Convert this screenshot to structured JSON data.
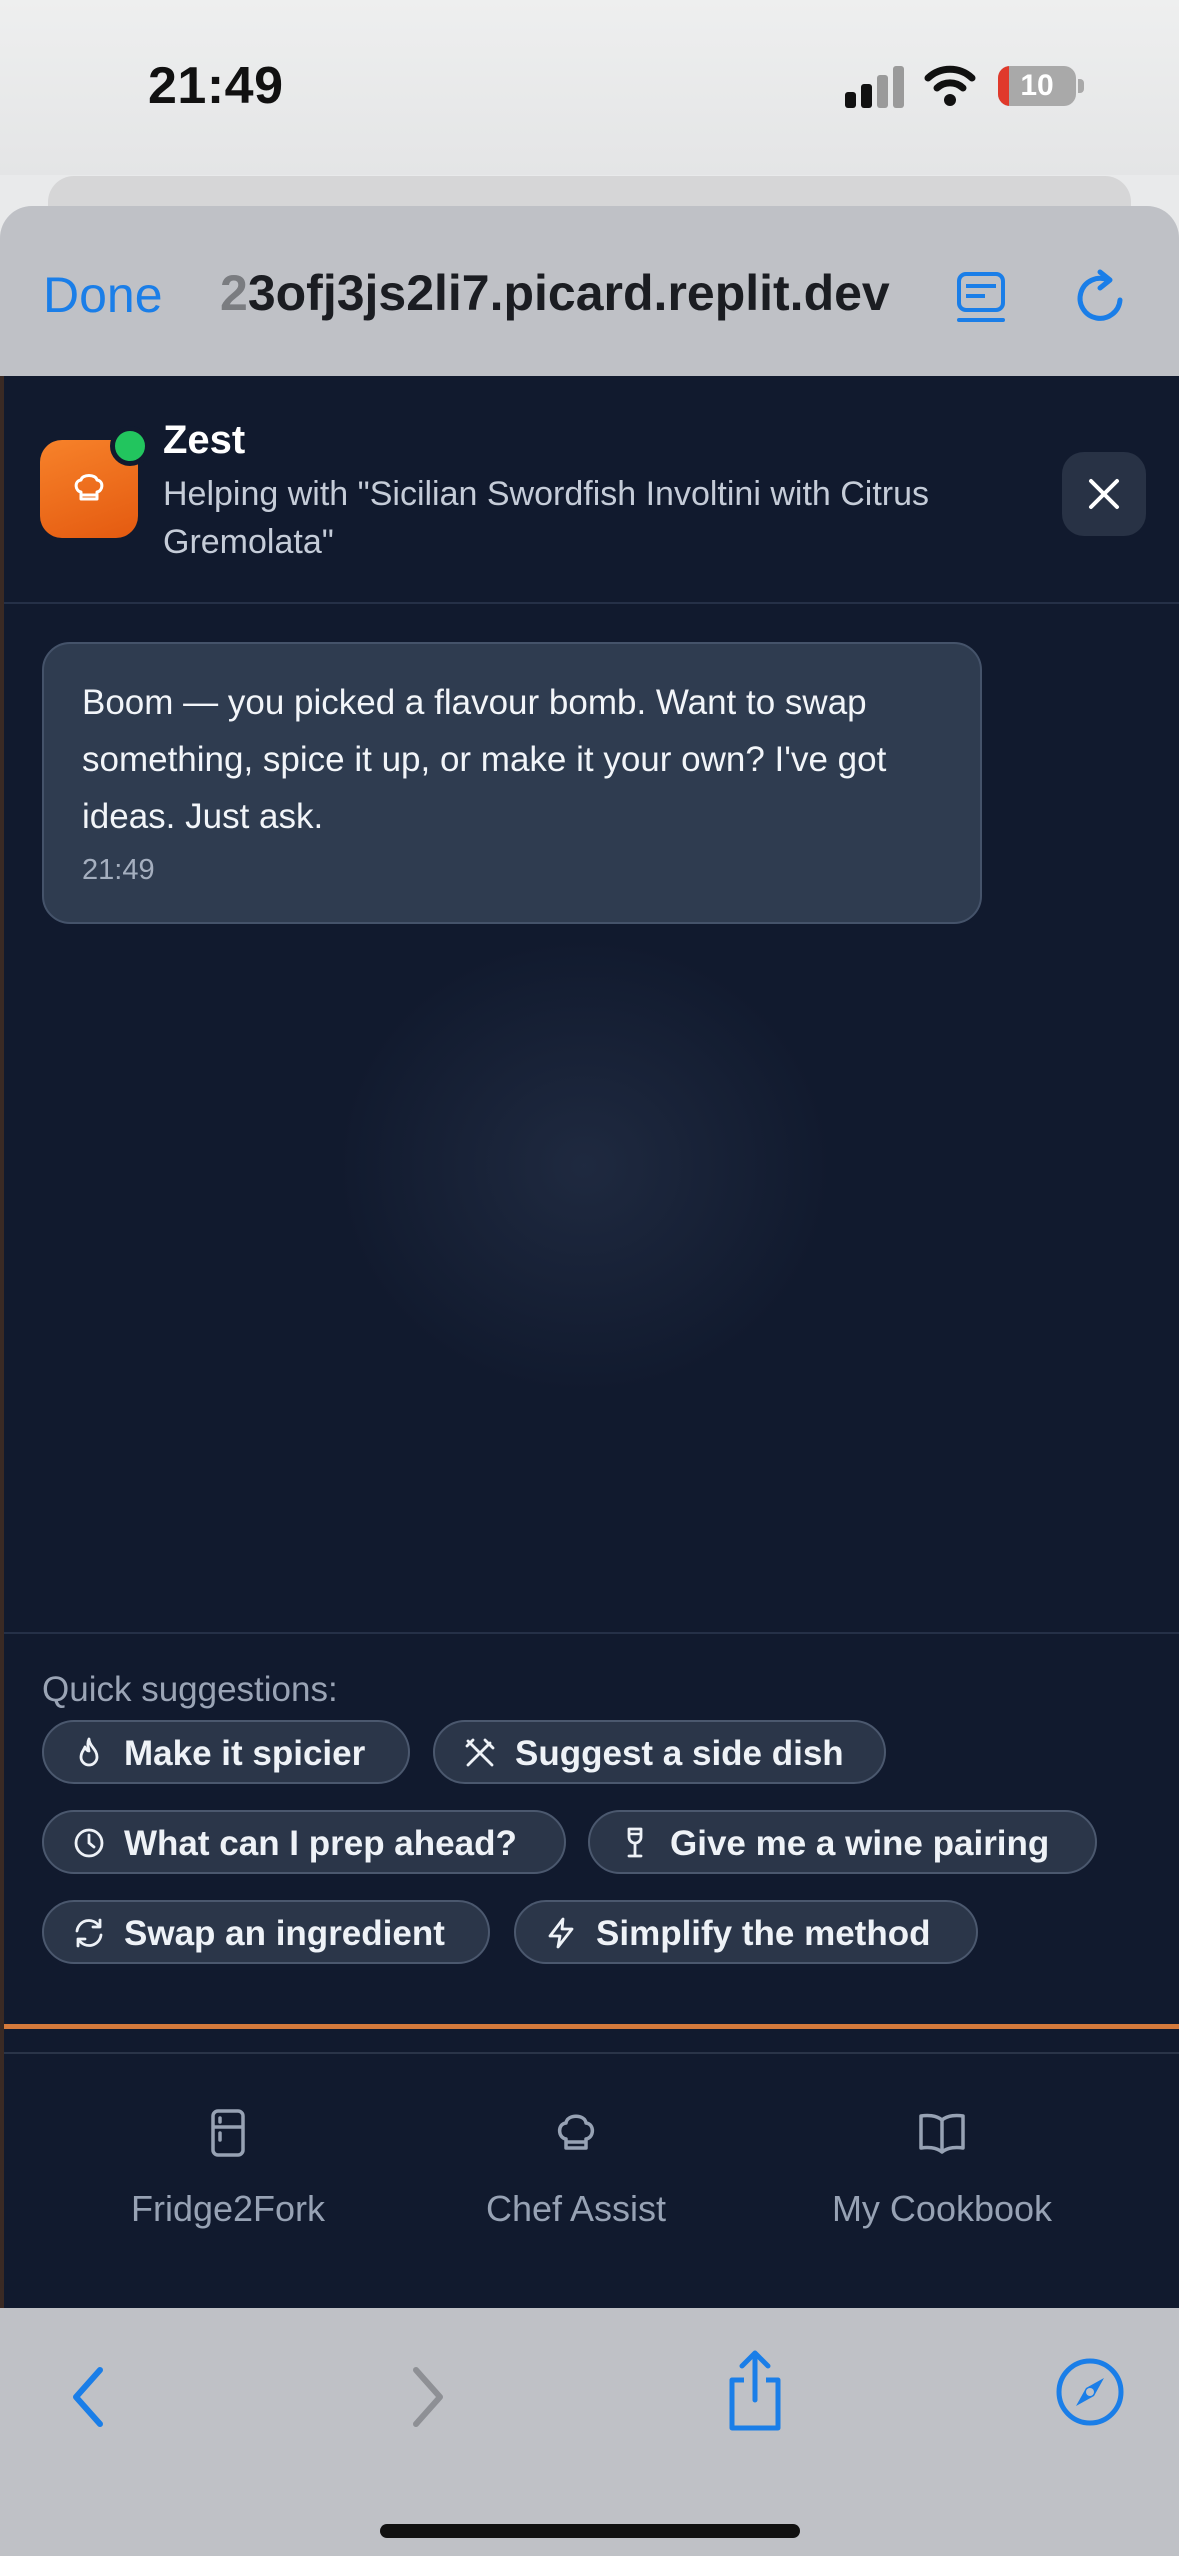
{
  "status_bar": {
    "time": "21:49",
    "battery_percent": "10",
    "battery_color": "#e0392b"
  },
  "browser": {
    "done_label": "Done",
    "url_first_char": "2",
    "url_rest": "3ofj3js2li7.picard.replit.dev",
    "icons": [
      "reader-icon",
      "reload-icon"
    ]
  },
  "chat": {
    "bot_name": "Zest",
    "context": "Helping with \"Sicilian Swordfish Involtini with Citrus Gremolata\"",
    "accent_color": "#f7822a",
    "online_color": "#22c55e",
    "messages": [
      {
        "text": "Boom — you picked a flavour bomb. Want to swap something, spice it up, or make it your own? I've got ideas. Just ask.",
        "time": "21:49"
      }
    ]
  },
  "suggestions": {
    "label": "Quick suggestions:",
    "chips": [
      {
        "label": "Make it spicier",
        "icon": "flame-icon"
      },
      {
        "label": "Suggest a side dish",
        "icon": "utensils-crossed-icon"
      },
      {
        "label": "What can I prep ahead?",
        "icon": "clock-icon"
      },
      {
        "label": "Give me a wine pairing",
        "icon": "wine-glass-icon"
      },
      {
        "label": "Swap an ingredient",
        "icon": "refresh-icon"
      },
      {
        "label": "Simplify the method",
        "icon": "lightning-icon"
      }
    ]
  },
  "nav": {
    "items": [
      {
        "label": "Fridge2Fork",
        "icon": "fridge-icon"
      },
      {
        "label": "Chef Assist",
        "icon": "chef-hat-icon"
      },
      {
        "label": "My Cookbook",
        "icon": "book-icon"
      }
    ]
  },
  "toolbar": {
    "icons": [
      "back-icon",
      "forward-icon",
      "share-icon",
      "compass-icon"
    ]
  }
}
